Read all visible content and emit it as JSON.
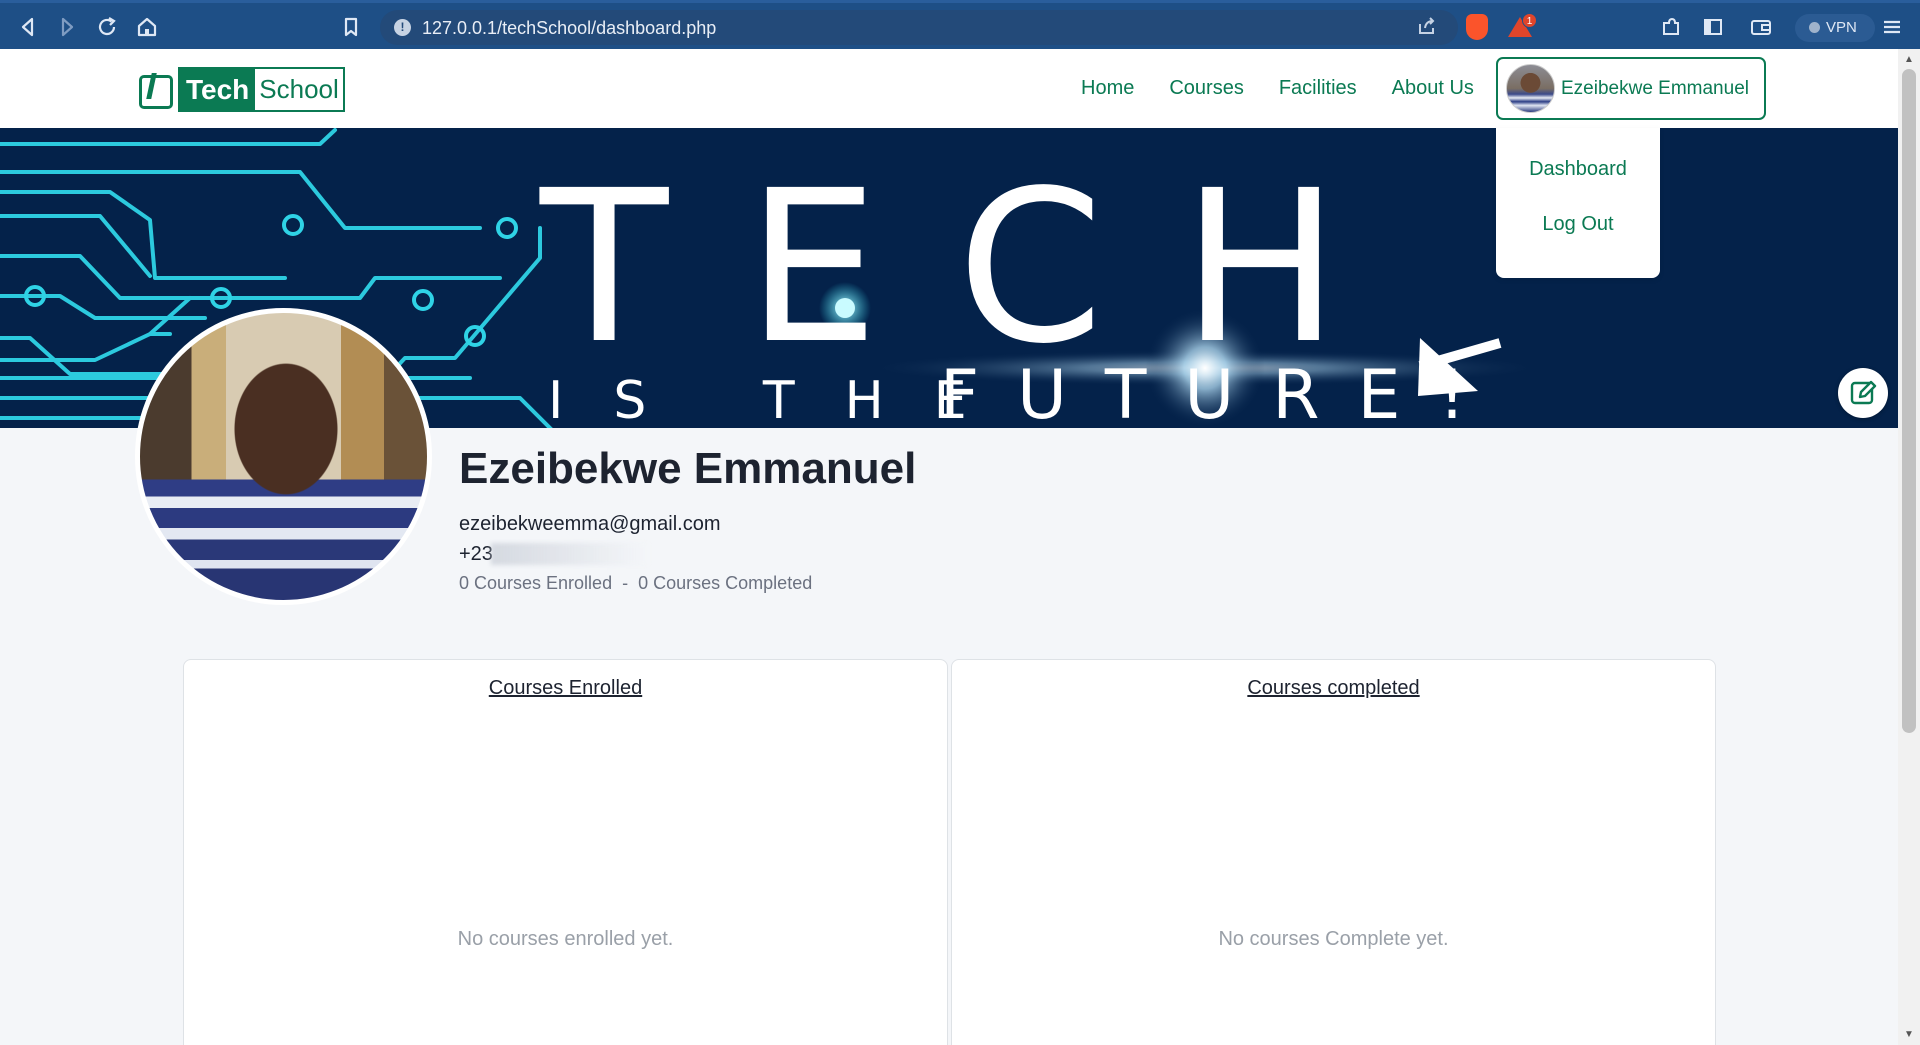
{
  "browser": {
    "url": "127.0.0.1/techSchool/dashboard.php",
    "vpn_label": "VPN",
    "rewards_count": "1"
  },
  "header": {
    "logo_part1": "Tech",
    "logo_part2": "School",
    "nav": [
      "Home",
      "Courses",
      "Facilities",
      "About Us"
    ],
    "user_name": "Ezeibekwe Emmanuel",
    "dropdown": [
      "Dashboard",
      "Log Out"
    ]
  },
  "banner": {
    "headline": "TECH",
    "tagline_1": "IS THE",
    "tagline_2": "FUTURE!"
  },
  "profile": {
    "name": "Ezeibekwe Emmanuel",
    "email": "ezeibekweemma@gmail.com",
    "phone_visible": "+23",
    "courses_enrolled": "0 Courses Enrolled",
    "separator": "-",
    "courses_completed": "0 Courses Completed"
  },
  "cards": {
    "enrolled_title": "Courses Enrolled",
    "enrolled_empty": "No courses enrolled yet.",
    "completed_title": "Courses completed",
    "completed_empty": "No courses Complete yet."
  },
  "colors": {
    "brand_green": "#0b7a53",
    "banner_navy": "#04224a",
    "circuit_cyan": "#2fd3e6",
    "chrome_blue": "#1e4f86"
  },
  "icons": {
    "back": "back-arrow-icon",
    "forward": "forward-arrow-icon",
    "reload": "reload-icon",
    "home": "home-icon",
    "bookmark": "bookmark-icon",
    "share": "share-icon",
    "edit": "edit-pencil-icon",
    "menu": "hamburger-menu-icon"
  }
}
